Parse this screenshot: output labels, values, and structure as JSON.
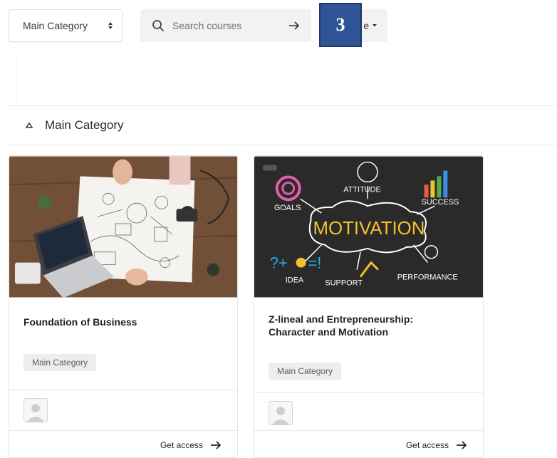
{
  "toolbar": {
    "category_select": "Main Category",
    "search_placeholder": "Search courses",
    "sort_suffix": "e"
  },
  "step_badge": "3",
  "section": {
    "title": "Main Category"
  },
  "courses": [
    {
      "title": "Foundation of Business",
      "category": "Main Category",
      "action": "Get access"
    },
    {
      "title": "Z-lineal and Entrepreneurship: Character and Motivation",
      "category": "Main Category",
      "action": "Get access",
      "image_words": {
        "attitude": "ATTITUDE",
        "goals": "GOALS",
        "success": "SUCCESS",
        "motivation": "MOTIVATION",
        "formula": "?+",
        "formula2": "=!",
        "idea": "IDEA",
        "support": "SUPPORT",
        "performance": "PERFORMANCE"
      }
    }
  ],
  "colors": {
    "badge": "#2f5597",
    "tag_bg": "#ededed",
    "motivation_text": "#f2c12e",
    "chalkboard": "#2a2a2a"
  }
}
